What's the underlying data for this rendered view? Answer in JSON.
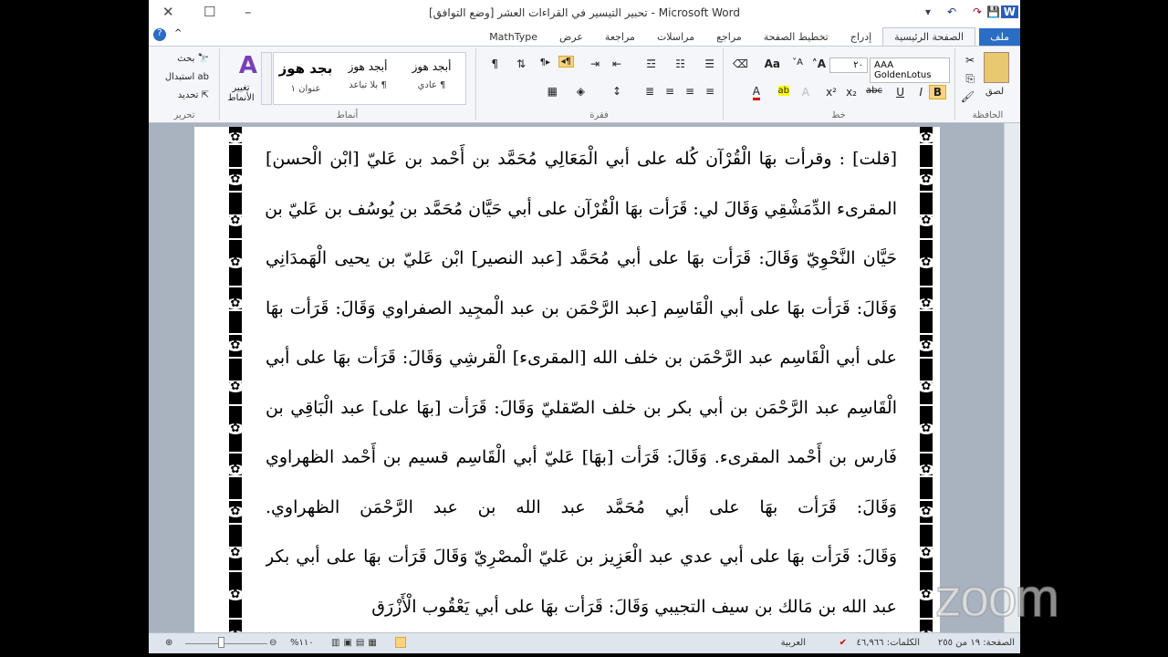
{
  "window": {
    "title": "تحبير التيسير في القراءات العشر [وضع التوافق] - Microsoft Word"
  },
  "tabs": [
    "ملف",
    "الصفحة الرئيسية",
    "إدراج",
    "تخطيط الصفحة",
    "مراجع",
    "مراسلات",
    "مراجعة",
    "عرض",
    "MathType"
  ],
  "ribbon": {
    "clipboard": {
      "label": "الحافظة",
      "paste": "لصق"
    },
    "font": {
      "label": "خط",
      "name": "AAA GoldenLotus",
      "size": "٢٠"
    },
    "paragraph": {
      "label": "فقرة"
    },
    "styles": {
      "label": "أنماط",
      "items": [
        {
          "preview": "أبجد هوز",
          "name": "¶ عادي"
        },
        {
          "preview": "أبجد هوز",
          "name": "¶ بلا تباعد"
        },
        {
          "preview": "بجد هوز",
          "name": "عنوان ١"
        }
      ],
      "change": "تغيير الأنماط"
    },
    "editing": {
      "label": "تحرير",
      "find": "بحث",
      "replace": "استبدال",
      "select": "تحديد"
    }
  },
  "document": {
    "lines": [
      "[قلت] : وقرأت بهَا الْقُرْآن كُله على أبي الْمَعَالِي مُحَمَّد بن أَحْمد بن عَليّ [ابْن الْحسن]",
      "المقرىء الدِّمَشْقِي وَقَالَ لي: قَرَأت بهَا الْقُرْآن على أبي حَيَّان مُحَمَّد بن يُوسُف بن عَليّ بن",
      "حَيَّان النَّحْوِيّ وَقَالَ: قَرَأت بهَا على أبي مُحَمَّد [عبد النصير] ابْن عَليّ بن يحيى الْهَمدَانِي",
      "وَقَالَ: قَرَأت بهَا على أبي الْقَاسِم [عبد الرَّحْمَن بن عبد الْمجِيد الصفراوي وَقَالَ: قَرَأت بهَا",
      "على أبي الْقَاسِم عبد الرَّحْمَن بن خلف الله [المقرىء] الْقرشِي وَقَالَ: قَرَأت بهَا على أبي",
      "الْقَاسِم عبد الرَّحْمَن بن أبي بكر بن خلف الصّقليّ وَقَالَ: قَرَأت [بهَا على] عبد الْبَاقِي بن",
      "فَارس بن أَحْمد المقرىء. وَقَالَ: قَرَأت [بهَا] عَليّ أبي الْقَاسِم قسيم بن أَحْمد الظهراوي",
      "وَقَالَ: قَرَأت بهَا على أبي مُحَمَّد عبد الله بن عبد الرَّحْمَن الظهراوي.",
      "وَقَالَ: قَرَأت بهَا على أبي عدي عبد الْعَزِيز بن عَليّ الْمصْرِيّ وَقَالَ قَرَأت بهَا على أبي بكر",
      "عبد الله بن مَالك بن سيف التجيبي وَقَالَ: قَرَأت بهَا على أبي يَعْقُوب الْأَزْرَق"
    ]
  },
  "status": {
    "page": "الصفحة: ١٩ من ٢٥٥",
    "words": "الكلمات: ٤٦,٩٦٦",
    "language": "العربية",
    "zoom": "%١١٠"
  },
  "watermark": "zoom"
}
